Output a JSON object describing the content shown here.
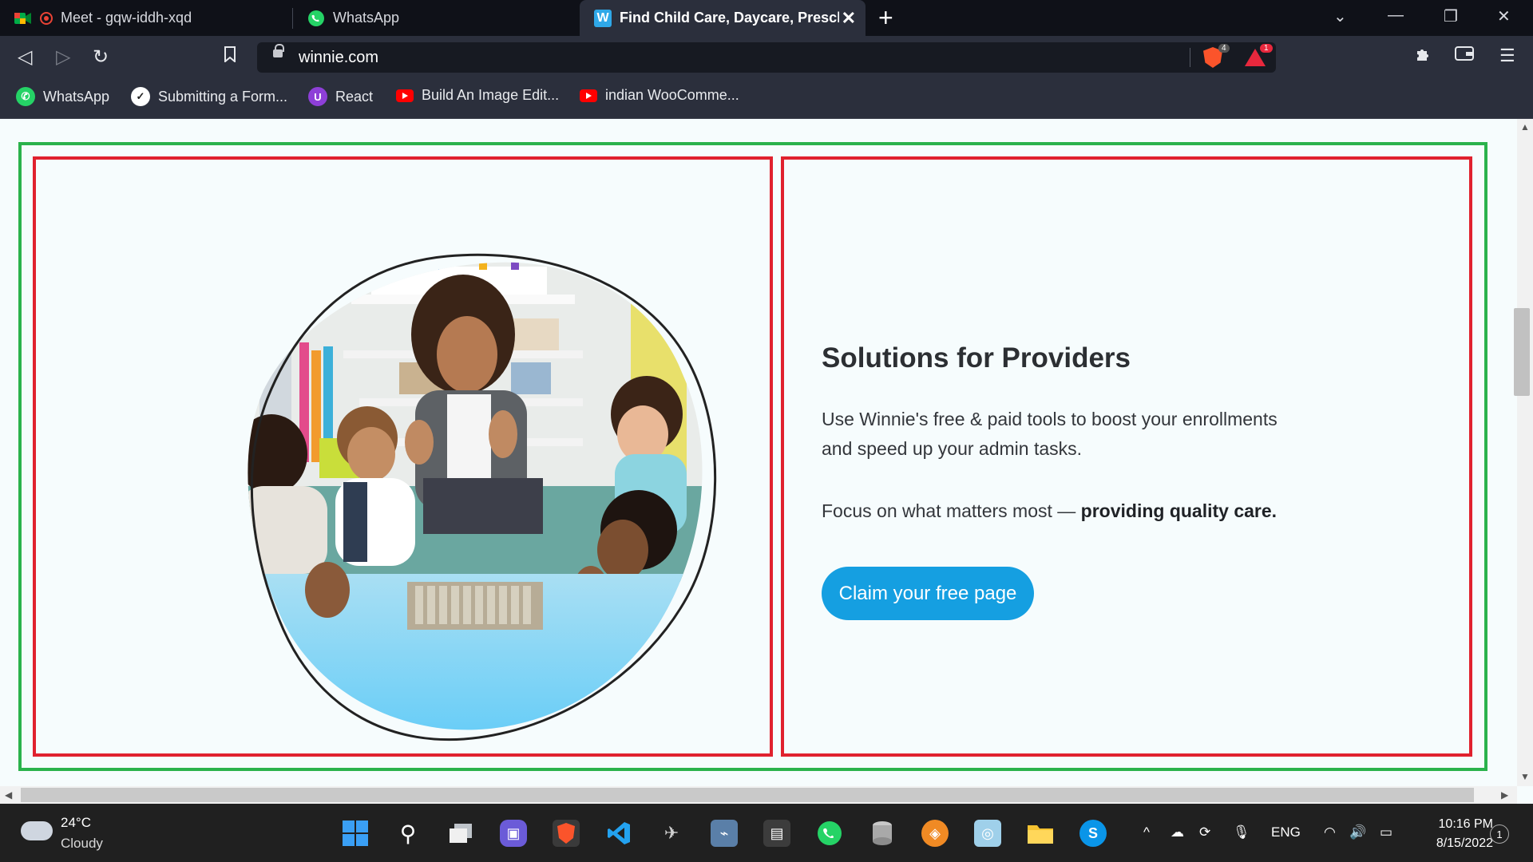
{
  "browser": {
    "tabs": [
      {
        "title": "Meet - gqw-iddh-xqd",
        "icon": "google-meet-icon"
      },
      {
        "title": "WhatsApp",
        "icon": "whatsapp-icon"
      },
      {
        "title": "Find Child Care, Daycare, Prescho",
        "icon": "winnie-icon",
        "active": true
      }
    ],
    "new_tab": "+",
    "url": "winnie.com",
    "shield_count": "4",
    "rewards_count": "1",
    "bookmarks": [
      {
        "label": "WhatsApp",
        "icon": "whatsapp-icon"
      },
      {
        "label": "Submitting a Form...",
        "icon": "check-circle-icon"
      },
      {
        "label": "React",
        "icon": "react-ext-icon"
      },
      {
        "label": "Build An Image Edit...",
        "icon": "youtube-icon"
      },
      {
        "label": "indian WooComme...",
        "icon": "youtube-icon"
      }
    ]
  },
  "content": {
    "heading": "Solutions for Providers",
    "paragraph": "Use Winnie's free & paid tools to boost your enrollments and speed up your admin tasks.",
    "focus_prefix": "Focus on what matters most — ",
    "focus_bold": "providing quality care.",
    "cta_label": "Claim your free page",
    "image_alt": "teacher-and-children-photo",
    "colors": {
      "cta": "#159fe1",
      "outer_border": "#2bb24c",
      "inner_border": "#e0212e"
    }
  },
  "taskbar": {
    "weather_temp": "24°C",
    "weather_desc": "Cloudy",
    "language": "ENG",
    "time": "10:16 PM",
    "date": "8/15/2022",
    "notifications": "1"
  }
}
